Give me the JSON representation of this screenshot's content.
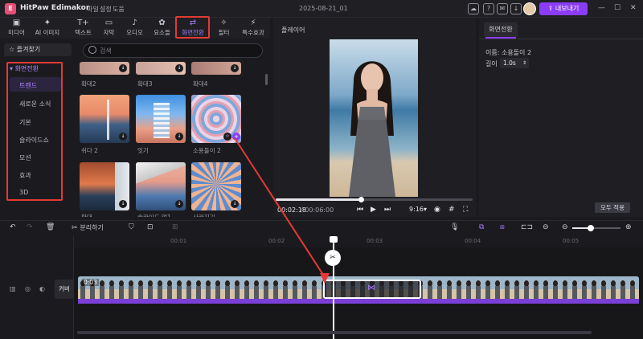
{
  "app": {
    "name": "HitPaw Edimakor",
    "logo_letter": "E",
    "menus": [
      "파일",
      "설정",
      "도움"
    ],
    "project_title": "2025-08-21_01",
    "export_label": "내보내기",
    "win_controls": [
      "—",
      "☐",
      "✕"
    ]
  },
  "toolbar": {
    "items": [
      {
        "icon": "▣",
        "label": "미디어"
      },
      {
        "icon": "✦",
        "label": "AI 이미지"
      },
      {
        "icon": "T+",
        "label": "텍스트"
      },
      {
        "icon": "▭",
        "label": "자막"
      },
      {
        "icon": "♪",
        "label": "오디오"
      },
      {
        "icon": "✿",
        "label": "요소들"
      },
      {
        "icon": "⇄",
        "label": "화면전환"
      },
      {
        "icon": "✧",
        "label": "필터"
      },
      {
        "icon": "⚡",
        "label": "특수효과"
      }
    ]
  },
  "sidebar": {
    "favorites": "즐겨찾기",
    "header": "화면전환",
    "items": [
      "트렌드",
      "새로운 소식",
      "기본",
      "슬라이드쇼",
      "모션",
      "효과",
      "3D"
    ]
  },
  "grid": {
    "search_placeholder": "검색",
    "partial_labels": [
      "확대2",
      "확대3",
      "확대4"
    ],
    "items": [
      {
        "label": "쉬다 2"
      },
      {
        "label": "잇기"
      },
      {
        "label": "소용돌이 2"
      }
    ],
    "bottom_labels": [
      "확대",
      "슬라이드 업1",
      "사라지기"
    ]
  },
  "player": {
    "label": "플레이어",
    "time_current": "00:02:18",
    "time_total": "/ 00:06:00",
    "aspect": "9:16",
    "progress": 0.38
  },
  "properties": {
    "tab": "화면전환",
    "name_line": "이름: 소용돌이 2",
    "duration_label": "길이",
    "duration_value": "1.0s",
    "apply_all": "모두 적용"
  },
  "timeline": {
    "split_label": "분리하기",
    "ticks": [
      "00:01",
      "00:02",
      "00:03",
      "00:04",
      "00:05"
    ],
    "clip_duration": "0:03",
    "cover_label": "커버"
  },
  "colors": {
    "accent": "#8b3cf6",
    "highlight": "#e53935"
  }
}
